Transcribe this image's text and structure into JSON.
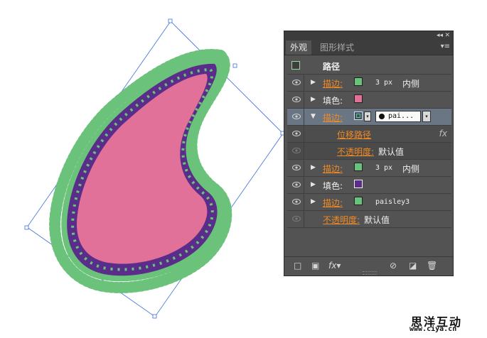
{
  "panel": {
    "tabs": [
      "外观",
      "图形样式"
    ],
    "header_title": "路径",
    "rows": [
      {
        "label": "描边:",
        "swatch": "#6bc27a",
        "value": "3 px",
        "extra": "内侧"
      },
      {
        "label": "填色:",
        "swatch": "#e27199"
      },
      {
        "label": "描边:",
        "swatch": "#6bc27a",
        "brush": "pai..."
      },
      {
        "label": "位移路径",
        "fx": "fx"
      },
      {
        "label": "不透明度:",
        "value": "默认值"
      },
      {
        "label": "描边:",
        "swatch": "#6bc27a",
        "value": "3 px",
        "extra": "内侧"
      },
      {
        "label": "填色:",
        "swatch": "#5a2d8a"
      },
      {
        "label": "描边:",
        "swatch": "#6bc27a",
        "value": "paisley3"
      },
      {
        "label": "不透明度:",
        "value": "默认值"
      }
    ],
    "bottom_icons": [
      "new-stroke-icon",
      "new-fill-icon",
      "fx-icon",
      "clear-icon",
      "duplicate-icon",
      "delete-icon"
    ],
    "fx_label": "fx"
  },
  "colors": {
    "fill_pink": "#e27199",
    "fill_purple": "#5a2d8a",
    "stroke_green": "#6bc27a",
    "selection_blue": "#3a6fd8"
  },
  "watermark": {
    "title": "思洋互动",
    "url": "www.ciya.cn"
  }
}
